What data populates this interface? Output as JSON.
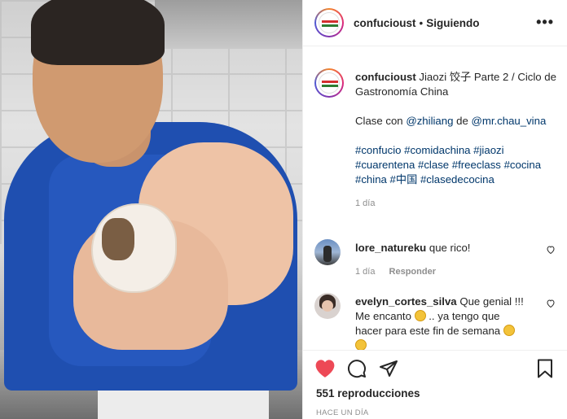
{
  "header": {
    "username": "confucioust",
    "separator": "•",
    "follow_status": "Siguiendo",
    "more_icon": "more-horizontal-icon"
  },
  "caption": {
    "username": "confucioust",
    "title_line": "Jiaozi 饺子 Parte 2 / Ciclo de Gastronomía China",
    "class_prefix": "Clase con",
    "mention_1": "@zhiliang",
    "mention_connector": "de",
    "mention_2": "@mr.chau_vina",
    "hashtags": [
      "#confucio",
      "#comidachina",
      "#jiaozi",
      "#cuarentena",
      "#clase",
      "#freeclass",
      "#cocina",
      "#china",
      "#中国",
      "#clasedecocina"
    ],
    "time": "1 día"
  },
  "comments": [
    {
      "username": "lore_natureku",
      "text": "que rico!",
      "time": "1 día",
      "reply_label": "Responder"
    },
    {
      "username": "evelyn_cortes_silva",
      "text_1": "Que genial !!! Me encanto",
      "text_2": ".. ya tengo que hacer para este fin de semana"
    }
  ],
  "footer": {
    "views": "551 reproducciones",
    "posted": "HACE UN DÍA"
  },
  "colors": {
    "like_red": "#ed4956",
    "link_blue": "#00376b",
    "secondary_text": "#8e8e8e"
  }
}
